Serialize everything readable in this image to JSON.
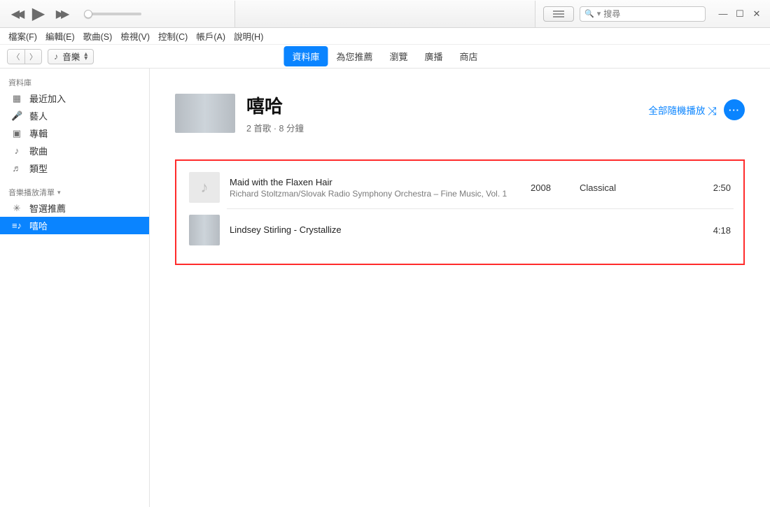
{
  "search": {
    "placeholder": "搜尋"
  },
  "menus": [
    "檔案(F)",
    "編輯(E)",
    "歌曲(S)",
    "檢視(V)",
    "控制(C)",
    "帳戶(A)",
    "說明(H)"
  ],
  "library_picker": "音樂",
  "center_tabs": [
    "資料庫",
    "為您推薦",
    "瀏覽",
    "廣播",
    "商店"
  ],
  "center_tab_active": 0,
  "sidebar": {
    "section_library": "資料庫",
    "items_library": [
      "最近加入",
      "藝人",
      "專輯",
      "歌曲",
      "類型"
    ],
    "section_playlists": "音樂播放清單",
    "items_playlists": [
      "智選推薦",
      "嘻哈"
    ],
    "selected_playlist_index": 1
  },
  "playlist": {
    "title": "嘻哈",
    "subtitle": "2 首歌 · 8 分鐘",
    "shuffle_label": "全部隨機播放"
  },
  "tracks": [
    {
      "title": "Maid with the Flaxen Hair",
      "subtitle": "Richard Stoltzman/Slovak Radio Symphony Orchestra – Fine Music, Vol. 1",
      "year": "2008",
      "genre": "Classical",
      "duration": "2:50",
      "thumb": "note"
    },
    {
      "title": "Lindsey Stirling - Crystallize",
      "subtitle": "",
      "year": "",
      "genre": "",
      "duration": "4:18",
      "thumb": "video"
    }
  ]
}
